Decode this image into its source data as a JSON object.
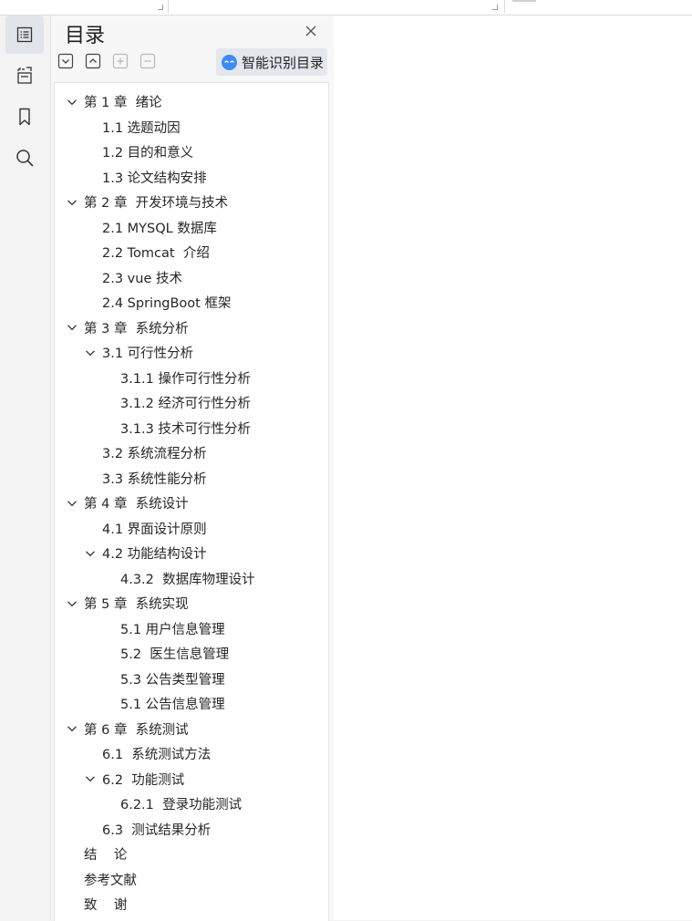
{
  "top_strip": {},
  "rail": {
    "items": [
      {
        "name": "outline",
        "icon": "toc-outline-icon",
        "active": true
      },
      {
        "name": "selection",
        "icon": "text-selection-icon"
      },
      {
        "name": "bookmark",
        "icon": "bookmark-icon"
      },
      {
        "name": "search",
        "icon": "search-icon"
      }
    ]
  },
  "panel": {
    "title": "目录",
    "close_icon": "close-icon",
    "tools": [
      {
        "name": "expand-all",
        "icon": "chevron-down-box-icon",
        "enabled": true
      },
      {
        "name": "collapse-all",
        "icon": "chevron-up-box-icon",
        "enabled": true
      },
      {
        "name": "add-heading",
        "icon": "plus-box-icon",
        "enabled": false
      },
      {
        "name": "remove-heading",
        "icon": "minus-box-icon",
        "enabled": false
      }
    ],
    "smart_button": {
      "label": "智能识别目录",
      "icon": "smart-recognize-icon"
    }
  },
  "toc": [
    {
      "label": "第 1 章  绪论",
      "level": 0,
      "expanded": true
    },
    {
      "label": "1.1 选题动因",
      "level": 1
    },
    {
      "label": "1.2 目的和意义",
      "level": 1
    },
    {
      "label": "1.3 论文结构安排",
      "level": 1
    },
    {
      "label": "第 2 章  开发环境与技术",
      "level": 0,
      "expanded": true
    },
    {
      "label": "2.1 MYSQL 数据库",
      "level": 1
    },
    {
      "label": "2.2 Tomcat  介绍",
      "level": 1
    },
    {
      "label": "2.3 vue 技术",
      "level": 1
    },
    {
      "label": "2.4 SpringBoot 框架",
      "level": 1
    },
    {
      "label": "第 3 章  系统分析",
      "level": 0,
      "expanded": true
    },
    {
      "label": "3.1 可行性分析",
      "level": 1,
      "expanded": true
    },
    {
      "label": "3.1.1 操作可行性分析",
      "level": 2
    },
    {
      "label": "3.1.2 经济可行性分析",
      "level": 2
    },
    {
      "label": "3.1.3 技术可行性分析",
      "level": 2
    },
    {
      "label": "3.2 系统流程分析",
      "level": 1
    },
    {
      "label": "3.3 系统性能分析",
      "level": 1
    },
    {
      "label": "第 4 章  系统设计",
      "level": 0,
      "expanded": true
    },
    {
      "label": "4.1 界面设计原则",
      "level": 1
    },
    {
      "label": "4.2 功能结构设计",
      "level": 1,
      "expanded": true
    },
    {
      "label": "4.3.2  数据库物理设计",
      "level": 2
    },
    {
      "label": "第 5 章  系统实现",
      "level": 0,
      "expanded": true
    },
    {
      "label": "5.1 用户信息管理",
      "level": 2
    },
    {
      "label": "5.2  医生信息管理",
      "level": 2
    },
    {
      "label": "5.3 公告类型管理",
      "level": 2
    },
    {
      "label": "5.1 公告信息管理",
      "level": 2
    },
    {
      "label": "第 6 章  系统测试",
      "level": 0,
      "expanded": true
    },
    {
      "label": "6.1  系统测试方法",
      "level": 1
    },
    {
      "label": "6.2  功能测试",
      "level": 1,
      "expanded": true
    },
    {
      "label": "6.2.1  登录功能测试",
      "level": 2
    },
    {
      "label": "6.3  测试结果分析",
      "level": 1
    },
    {
      "label": "结    论",
      "level": 0
    },
    {
      "label": "参考文献",
      "level": 0
    },
    {
      "label": "致    谢",
      "level": 0
    }
  ]
}
